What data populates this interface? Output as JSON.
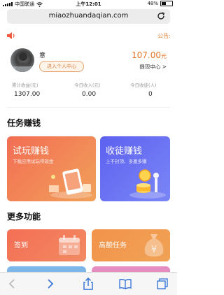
{
  "status": {
    "carrier": "中国联通",
    "time": "上午12:01",
    "battery": "48%"
  },
  "browser": {
    "url": "miaozhuandaqian.com"
  },
  "notice": {
    "label": "公告:"
  },
  "user": {
    "name": "意",
    "personal_center": "进入个人中心",
    "balance": "107.00",
    "balance_unit": "元",
    "withdraw": "提现中心 >"
  },
  "stats": [
    {
      "label": "累计收益(元)",
      "value": "1307.00"
    },
    {
      "label": "今日收入(元)",
      "value": "0.00"
    },
    {
      "label": "今日收徒(人)",
      "value": "0"
    }
  ],
  "tasks_section": {
    "title": "任务赚钱"
  },
  "tasks": [
    {
      "title": "试玩赚钱",
      "subtitle": "下载应用试玩得现金"
    },
    {
      "title": "收徒赚钱",
      "subtitle": "上不封顶、多邀多赚"
    }
  ],
  "more_section": {
    "title": "更多功能"
  },
  "features": [
    {
      "label": "签到"
    },
    {
      "label": "高额任务"
    }
  ],
  "colors": {
    "accent": "#e6782d",
    "trial_card": "#f26d54",
    "invite_card": "#5d61f0"
  }
}
